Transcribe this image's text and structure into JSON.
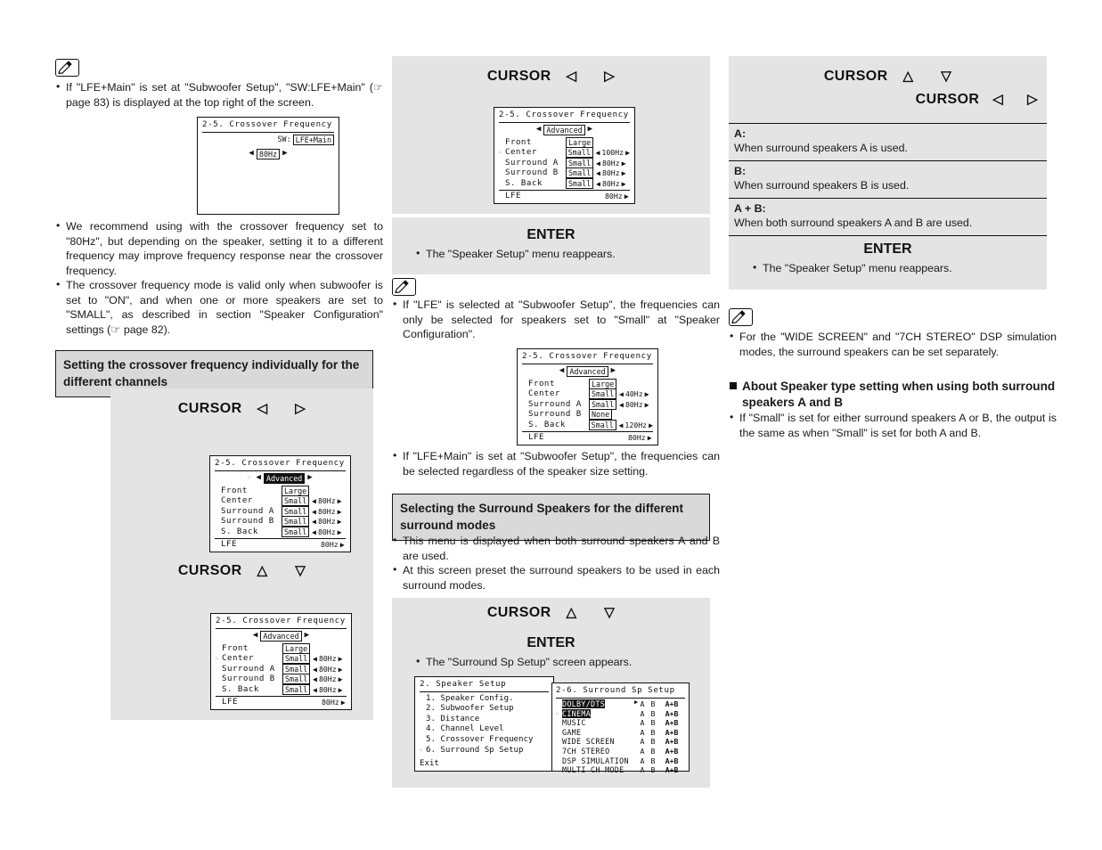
{
  "col1": {
    "note1_bullet": "If \"LFE+Main\" is set at \"Subwoofer Setup\", \"SW:LFE+Main\" (☞ page 83) is displayed at the top right of the screen.",
    "osd_sw": {
      "title": "2-5. Crossover Frequency",
      "sw_label": "SW:",
      "sw_tag": "LFE+Main",
      "value": "80Hz",
      "arrow_left": "◀",
      "arrow_right": "▶"
    },
    "bullets": [
      "We recommend using with the crossover frequency set to \"80Hz\", but depending on the speaker, setting it to a different frequency may improve frequency response near the crossover frequency.",
      "The crossover frequency mode is valid only when subwoofer is set to \"ON\", and when one or more speakers are set to \"SMALL\", as described in section \"Speaker Configuration\" settings (☞ page 82)."
    ],
    "section_head": "Setting the crossover frequency individually for the different channels",
    "cursor_lr": "CURSOR",
    "cursor_ud": "CURSOR",
    "osd_a": {
      "title": "2-5. Crossover Frequency",
      "advanced": "Advanced",
      "cursor_mark": "☞",
      "rows": [
        {
          "name": "Front",
          "size": "Large",
          "size_inv": false,
          "freq": "",
          "show_freq": false,
          "mark": ""
        },
        {
          "name": "Center",
          "size": "Small",
          "size_inv": false,
          "freq": "80Hz",
          "show_freq": true,
          "mark": ""
        },
        {
          "name": "Surround A",
          "size": "Small",
          "size_inv": false,
          "freq": "80Hz",
          "show_freq": true,
          "mark": ""
        },
        {
          "name": "Surround B",
          "size": "Small",
          "size_inv": false,
          "freq": "80Hz",
          "show_freq": true,
          "mark": ""
        },
        {
          "name": "S. Back",
          "size": "Small",
          "size_inv": false,
          "freq": "80Hz",
          "show_freq": true,
          "mark": ""
        },
        {
          "name": "LFE",
          "size": "",
          "size_inv": false,
          "freq": "80Hz",
          "show_freq": true,
          "mark": ""
        }
      ]
    },
    "osd_b": {
      "title": "2-5. Crossover Frequency",
      "advanced": "Advanced",
      "rows": [
        {
          "name": "Front",
          "size": "Large",
          "freq": "",
          "show_freq": false,
          "mark": ""
        },
        {
          "name": "Center",
          "size": "Small",
          "freq": "80Hz",
          "show_freq": true,
          "mark": "☞"
        },
        {
          "name": "Surround A",
          "size": "Small",
          "freq": "80Hz",
          "show_freq": true,
          "mark": ""
        },
        {
          "name": "Surround B",
          "size": "Small",
          "freq": "80Hz",
          "show_freq": true,
          "mark": ""
        },
        {
          "name": "S. Back",
          "size": "Small",
          "freq": "80Hz",
          "show_freq": true,
          "mark": ""
        },
        {
          "name": "LFE",
          "size": "",
          "freq": "80Hz",
          "show_freq": true,
          "mark": ""
        }
      ]
    }
  },
  "col2": {
    "cursor_lr": "CURSOR",
    "osd_top": {
      "title": "2-5. Crossover Frequency",
      "advanced": "Advanced",
      "rows": [
        {
          "name": "Front",
          "size": "Large",
          "freq": "",
          "show_freq": false,
          "mark": ""
        },
        {
          "name": "Center",
          "size": "Small",
          "freq": "100Hz",
          "show_freq": true,
          "mark": "☞"
        },
        {
          "name": "Surround A",
          "size": "Small",
          "freq": "80Hz",
          "show_freq": true,
          "mark": ""
        },
        {
          "name": "Surround B",
          "size": "Small",
          "freq": "80Hz",
          "show_freq": true,
          "mark": ""
        },
        {
          "name": "S. Back",
          "size": "Small",
          "freq": "80Hz",
          "show_freq": true,
          "mark": ""
        },
        {
          "name": "LFE",
          "size": "",
          "freq": "80Hz",
          "show_freq": true,
          "mark": ""
        }
      ]
    },
    "enter": "ENTER",
    "enter_note": "The \"Speaker Setup\" menu reappears.",
    "note_bullet": "If \"LFE\" is selected at \"Subwoofer Setup\", the frequencies can only be selected for speakers set to \"Small\" at \"Speaker Configuration\".",
    "osd_lfe": {
      "title": "2-5. Crossover Frequency",
      "advanced": "Advanced",
      "rows": [
        {
          "name": "Front",
          "size": "Large",
          "freq": "",
          "show_freq": false,
          "mark": ""
        },
        {
          "name": "Center",
          "size": "Small",
          "freq": "40Hz",
          "show_freq": true,
          "mark": ""
        },
        {
          "name": "Surround A",
          "size": "Small",
          "freq": "80Hz",
          "show_freq": true,
          "mark": ""
        },
        {
          "name": "Surround B",
          "size": "None",
          "freq": "",
          "show_freq": false,
          "mark": ""
        },
        {
          "name": "S. Back",
          "size": "Small",
          "freq": "120Hz",
          "show_freq": true,
          "mark": ""
        },
        {
          "name": "LFE",
          "size": "",
          "freq": "80Hz",
          "show_freq": true,
          "mark": ""
        }
      ]
    },
    "after_bullet": "If \"LFE+Main\" is set at \"Subwoofer Setup\", the frequencies can be selected regardless of the speaker size setting.",
    "section_head": "Selecting the Surround Speakers for the different surround modes",
    "bullets": [
      "This menu is displayed when both surround speakers A and B are used.",
      "At this screen preset the surround speakers to be used in each surround modes."
    ],
    "cursor_ud": "CURSOR",
    "enter2": "ENTER",
    "enter2_note": "The \"Surround Sp Setup\" screen appears.",
    "osd_speaker_setup": {
      "title": "2. Speaker Setup",
      "items": [
        "1. Speaker Config.",
        "2. Subwoofer Setup",
        "3. Distance",
        "4. Channel Level",
        "5. Crossover Frequency",
        "6. Surround Sp Setup"
      ],
      "cursor_index": 5,
      "cursor_mark": "☞",
      "exit": "Exit"
    },
    "osd_surround_sp": {
      "title": "2-6. Surround Sp Setup",
      "cursor_mark": "☞",
      "rows": [
        {
          "name": "DOLBY/DTS",
          "highlight": true,
          "cursor": false,
          "a": "A",
          "b": "B",
          "ab": "A+B",
          "sel": 2
        },
        {
          "name": "CINEMA",
          "highlight": true,
          "cursor": true,
          "a": "A",
          "b": "B",
          "ab": "A+B",
          "sel": 2
        },
        {
          "name": "MUSIC",
          "highlight": false,
          "cursor": false,
          "a": "A",
          "b": "B",
          "ab": "A+B",
          "sel": 2
        },
        {
          "name": "GAME",
          "highlight": false,
          "cursor": false,
          "a": "A",
          "b": "B",
          "ab": "A+B",
          "sel": 2
        },
        {
          "name": "WIDE SCREEN",
          "highlight": false,
          "cursor": false,
          "a": "A",
          "b": "B",
          "ab": "A+B",
          "sel": 2
        },
        {
          "name": "7CH STEREO",
          "highlight": false,
          "cursor": false,
          "a": "A",
          "b": "B",
          "ab": "A+B",
          "sel": 2
        },
        {
          "name": "DSP SIMULATION",
          "highlight": false,
          "cursor": false,
          "a": "A",
          "b": "B",
          "ab": "A+B",
          "sel": 2
        },
        {
          "name": "MULTI CH MODE",
          "highlight": false,
          "cursor": false,
          "a": "A",
          "b": "B",
          "ab": "A+B",
          "sel": 2
        }
      ]
    }
  },
  "col3": {
    "cursor_ud": "CURSOR",
    "cursor_lr": "CURSOR",
    "ab_rows": [
      {
        "key": "A:",
        "value": "When surround speakers A is used."
      },
      {
        "key": "B:",
        "value": "When surround speakers B is used."
      },
      {
        "key": "A + B:",
        "value": "When both surround speakers A and B are used."
      }
    ],
    "enter": "ENTER",
    "enter_note": "The \"Speaker Setup\" menu reappears.",
    "note_bullet": "For the \"WIDE SCREEN\" and \"7CH STEREO\" DSP simulation modes, the surround speakers can be set separately.",
    "subhead": "About Speaker type setting when using both surround speakers A and B",
    "sub_bullet": "If \"Small\" is set for either surround speakers A or B, the output is the same as when \"Small\" is set for both A and B."
  },
  "glyphs": {
    "tri_left": "◁",
    "tri_right": "▷",
    "tri_up": "△",
    "tri_down": "▽",
    "arrow_left": "◀",
    "arrow_right": "▶"
  }
}
